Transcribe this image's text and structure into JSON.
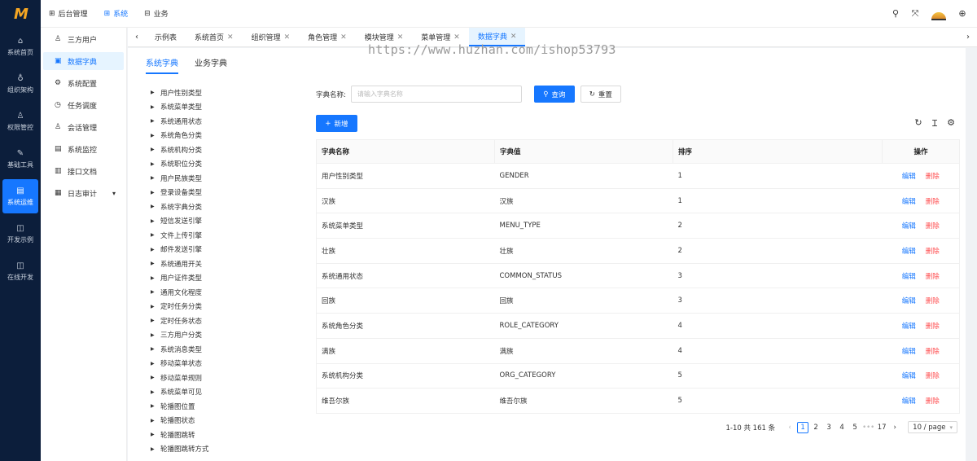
{
  "rail": {
    "items": [
      {
        "icon": "home-icon",
        "glyph": "⌂",
        "label": "系统首页"
      },
      {
        "icon": "org-icon",
        "glyph": "♁",
        "label": "组织架构"
      },
      {
        "icon": "user-icon",
        "glyph": "♙",
        "label": "权限管控"
      },
      {
        "icon": "tool-icon",
        "glyph": "✎",
        "label": "基础工具"
      },
      {
        "icon": "ops-icon",
        "glyph": "▤",
        "label": "系统运维"
      },
      {
        "icon": "example-icon",
        "glyph": "◫",
        "label": "开发示例"
      },
      {
        "icon": "dev-icon",
        "glyph": "◫",
        "label": "在线开发"
      }
    ]
  },
  "topnav": {
    "items": [
      {
        "glyph": "⊞",
        "label": "后台管理"
      },
      {
        "glyph": "⊞",
        "label": "系统"
      },
      {
        "glyph": "⊟",
        "label": "业务"
      }
    ]
  },
  "submenu": {
    "items": [
      {
        "glyph": "♙",
        "label": "三方用户"
      },
      {
        "glyph": "▣",
        "label": "数据字典"
      },
      {
        "glyph": "⚙",
        "label": "系统配置"
      },
      {
        "glyph": "◷",
        "label": "任务调度"
      },
      {
        "glyph": "♙",
        "label": "会话管理"
      },
      {
        "glyph": "▤",
        "label": "系统监控"
      },
      {
        "glyph": "▥",
        "label": "接口文档"
      },
      {
        "glyph": "▦",
        "label": "日志审计"
      }
    ]
  },
  "tabs": {
    "items": [
      "示例表",
      "系统首页",
      "组织管理",
      "角色管理",
      "模块管理",
      "菜单管理",
      "数据字典"
    ]
  },
  "watermark": "https://www.huzhan.com/ishop53793",
  "main": {
    "subtabs": [
      "系统字典",
      "业务字典"
    ],
    "tree": [
      "用户性别类型",
      "系统菜单类型",
      "系统通用状态",
      "系统角色分类",
      "系统机构分类",
      "系统职位分类",
      "用户民族类型",
      "登录设备类型",
      "系统字典分类",
      "短信发送引擎",
      "文件上传引擎",
      "邮件发送引擎",
      "系统通用开关",
      "用户证件类型",
      "通用文化程度",
      "定时任务分类",
      "定时任务状态",
      "三方用户分类",
      "系统消息类型",
      "移动菜单状态",
      "移动菜单规则",
      "系统菜单可见",
      "轮播图位置",
      "轮播图状态",
      "轮播图跳转",
      "轮播图跳转方式"
    ],
    "search": {
      "label": "字典名称:",
      "placeholder": "请输入字典名称",
      "query_label": "查询",
      "reset_label": "重置"
    },
    "add_label": "新增",
    "table": {
      "headers": [
        "字典名称",
        "字典值",
        "排序",
        "操作"
      ],
      "edit_label": "编辑",
      "delete_label": "删除",
      "rows": [
        [
          "用户性别类型",
          "GENDER",
          "1"
        ],
        [
          "汉族",
          "汉族",
          "1"
        ],
        [
          "系统菜单类型",
          "MENU_TYPE",
          "2"
        ],
        [
          "壮族",
          "壮族",
          "2"
        ],
        [
          "系统通用状态",
          "COMMON_STATUS",
          "3"
        ],
        [
          "回族",
          "回族",
          "3"
        ],
        [
          "系统角色分类",
          "ROLE_CATEGORY",
          "4"
        ],
        [
          "满族",
          "满族",
          "4"
        ],
        [
          "系统机构分类",
          "ORG_CATEGORY",
          "5"
        ],
        [
          "维吾尔族",
          "维吾尔族",
          "5"
        ]
      ]
    },
    "pagination": {
      "total": "1-10 共 161 条",
      "pages": [
        "1",
        "2",
        "3",
        "4",
        "5"
      ],
      "ellipsis": "•••",
      "last": "17",
      "page_size": "10 / page"
    }
  },
  "colors": {
    "accent": "#1677ff",
    "danger": "#ff4d4f",
    "rail": "#0c1e3b"
  }
}
